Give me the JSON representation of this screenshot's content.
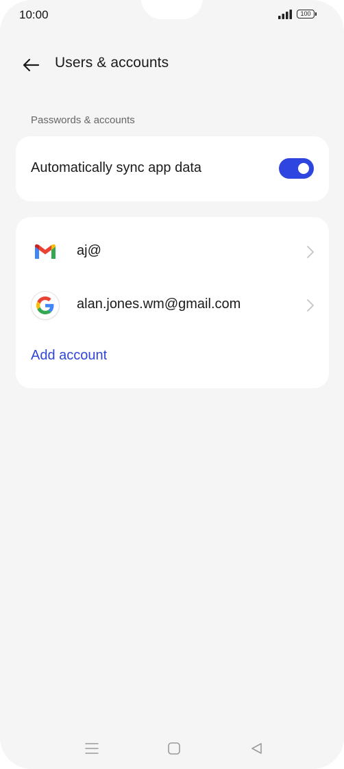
{
  "status_bar": {
    "time": "10:00",
    "battery": "100"
  },
  "header": {
    "title": "Users & accounts",
    "back_icon": "arrow-left-icon"
  },
  "section": {
    "label": "Passwords & accounts"
  },
  "sync": {
    "label": "Automatically sync app data",
    "enabled": true
  },
  "accounts": [
    {
      "icon": "gmail-icon",
      "label": "aj@"
    },
    {
      "icon": "google-icon",
      "label": "alan.jones.wm@gmail.com"
    }
  ],
  "add_account_label": "Add account",
  "colors": {
    "accent": "#2f45e0",
    "background": "#f5f5f5",
    "card": "#ffffff"
  },
  "nav_bar": {
    "icons": [
      "menu-icon",
      "home-square-icon",
      "back-triangle-icon"
    ]
  }
}
